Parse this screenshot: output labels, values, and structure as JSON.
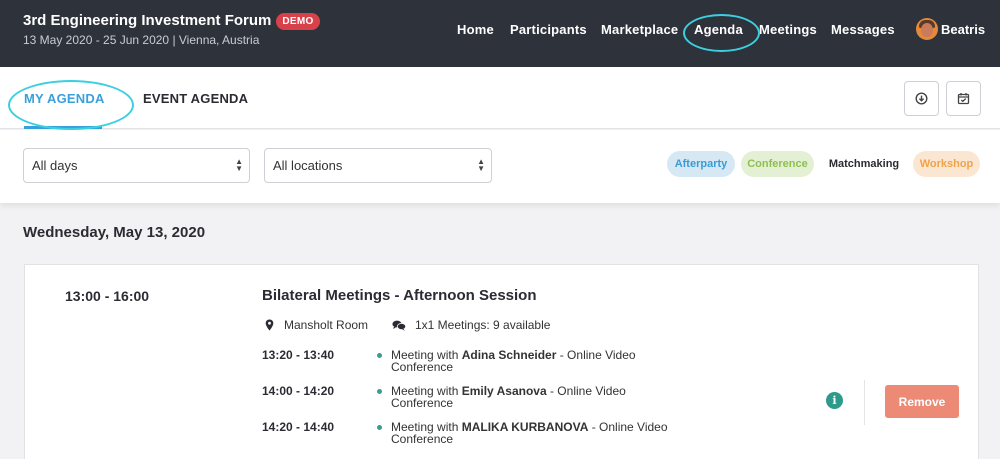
{
  "header": {
    "event_title": "3rd Engineering Investment Forum",
    "badge": "DEMO",
    "event_subtitle": "13 May 2020 - 25 Jun 2020 | Vienna, Austria",
    "nav": [
      "Home",
      "Participants",
      "Marketplace",
      "Agenda",
      "Meetings",
      "Messages"
    ],
    "active_nav": "Agenda",
    "user_name": "Beatris"
  },
  "tabs": {
    "my_agenda": "MY AGENDA",
    "event_agenda": "EVENT AGENDA",
    "active": "MY AGENDA",
    "download_icon": "download-circle-icon",
    "calendar_icon": "calendar-check-icon"
  },
  "filters": {
    "days_value": "All days",
    "locations_value": "All locations",
    "categories": [
      {
        "label": "Afterparty",
        "bg": "#d6e8f4",
        "color": "#3a9bd5"
      },
      {
        "label": "Conference",
        "bg": "#e4f0d3",
        "color": "#8fbf4f"
      },
      {
        "label": "Matchmaking",
        "bg": "#ffffff",
        "color": "#2b2b33"
      },
      {
        "label": "Workshop",
        "bg": "#fbe7d1",
        "color": "#f0a24c"
      }
    ]
  },
  "agenda": {
    "day": "Wednesday, May 13, 2020",
    "session": {
      "time": "13:00 - 16:00",
      "title": "Bilateral Meetings - Afternoon Session",
      "location": "Mansholt Room",
      "availability": "1x1 Meetings: 9 available",
      "meetings": [
        {
          "time": "13:20 - 13:40",
          "prefix": "Meeting with ",
          "name": "Adina Schneider",
          "suffix": " - Online Video Conference"
        },
        {
          "time": "14:00 - 14:20",
          "prefix": "Meeting with ",
          "name": "Emily Asanova",
          "suffix": " - Online Video Conference"
        },
        {
          "time": "14:20 - 14:40",
          "prefix": "Meeting with ",
          "name": "MALIKA KURBANOVA",
          "suffix": " - Online Video Conference"
        }
      ],
      "remove_label": "Remove",
      "info_glyph": "i"
    }
  },
  "colors": {
    "accent": "#3aa0dc",
    "header_bg": "#2e323b",
    "highlight_ring": "#3ccfe0",
    "remove": "#ec8a75",
    "teal": "#2e9a8b"
  }
}
